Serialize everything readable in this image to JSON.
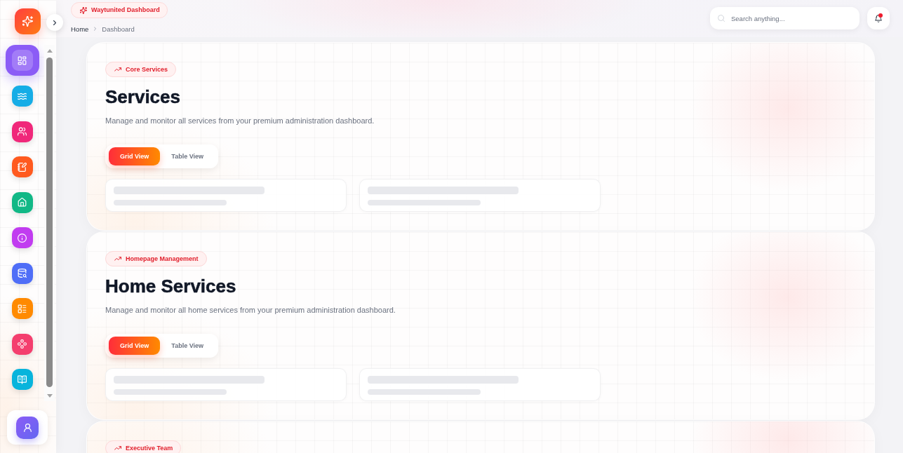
{
  "sidebar": {
    "items": [
      {
        "selected": true,
        "color": "#8b5cf6"
      },
      {
        "selected": false,
        "color": "#16ade6"
      },
      {
        "selected": false,
        "color": "#f0287a"
      },
      {
        "selected": false,
        "color": "#ff5a1f"
      },
      {
        "selected": false,
        "color": "#12b886"
      },
      {
        "selected": false,
        "color": "#c13cf0"
      },
      {
        "selected": false,
        "color": "#4f6ef7"
      },
      {
        "selected": false,
        "color": "#ff8a00"
      },
      {
        "selected": false,
        "color": "#f43f6e"
      },
      {
        "selected": false,
        "color": "#08b4dc"
      }
    ]
  },
  "header": {
    "badge": "Waytunited Dashboard",
    "breadcrumb": [
      "Home",
      "Dashboard"
    ],
    "search": {
      "placeholder": "Search anything..."
    },
    "notifications": {
      "unread": true
    }
  },
  "sections": [
    {
      "badge": "Core Services",
      "title": "Services",
      "description": "Manage and monitor all services from your premium administration dashboard.",
      "view_tabs": [
        {
          "label": "Grid View",
          "selected": true
        },
        {
          "label": "Table View",
          "selected": false
        }
      ],
      "placeholder_cards": [
        {
          "kind": "skeleton"
        },
        {
          "kind": "skeleton"
        }
      ]
    },
    {
      "badge": "Homepage Management",
      "title": "Home Services",
      "description": "Manage and monitor all home services from your premium administration dashboard.",
      "view_tabs": [
        {
          "label": "Grid View",
          "selected": true
        },
        {
          "label": "Table View",
          "selected": false
        }
      ],
      "placeholder_cards": [
        {
          "kind": "skeleton"
        },
        {
          "kind": "skeleton"
        }
      ]
    },
    {
      "badge": "Executive Team"
    }
  ]
}
